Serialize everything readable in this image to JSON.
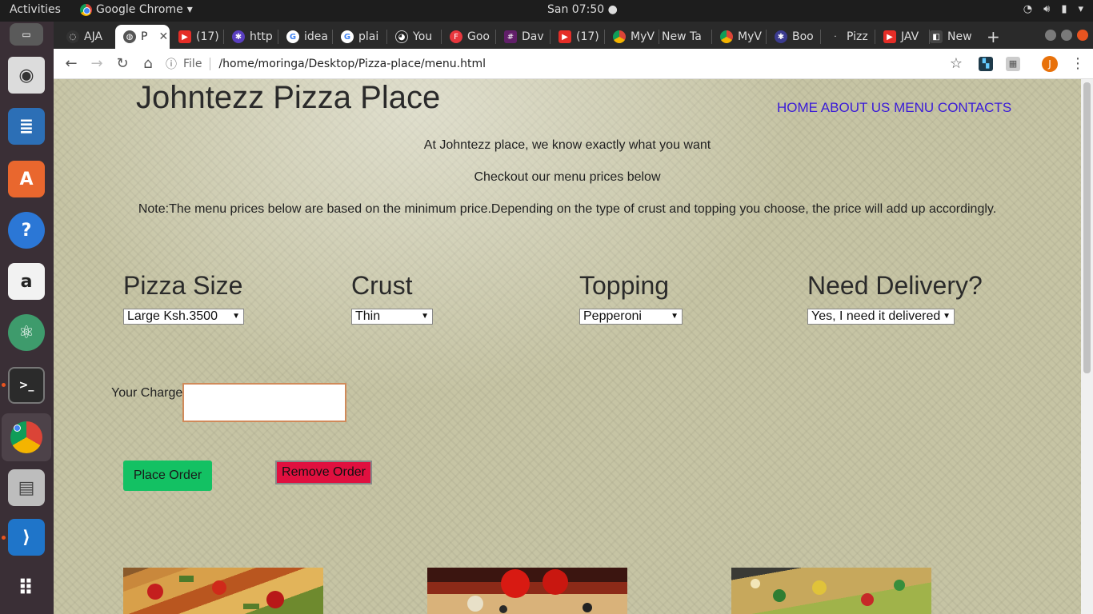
{
  "topbar": {
    "activities": "Activities",
    "app_name": "Google Chrome",
    "clock": "San 07:50"
  },
  "dock": {
    "items": [
      "rhythmbox",
      "libreoffice-writer",
      "ubuntu-software",
      "help",
      "amazon",
      "atom",
      "terminal",
      "chrome",
      "scanner",
      "vscode",
      "show-applications"
    ]
  },
  "tabs": [
    {
      "label": "AJA"
    },
    {
      "label": "P",
      "active": true
    },
    {
      "label": "(17)"
    },
    {
      "label": "http"
    },
    {
      "label": "idea"
    },
    {
      "label": "plai"
    },
    {
      "label": "You"
    },
    {
      "label": "Goo"
    },
    {
      "label": "Dav"
    },
    {
      "label": "(17)"
    },
    {
      "label": "MyV"
    },
    {
      "label": "New Ta"
    },
    {
      "label": "MyV"
    },
    {
      "label": "Boo"
    },
    {
      "label": "Pizz"
    },
    {
      "label": "JAV"
    },
    {
      "label": "New"
    }
  ],
  "toolbar": {
    "file_label": "File",
    "url": "/home/moringa/Desktop/Pizza-place/menu.html",
    "profile_initial": "J"
  },
  "page": {
    "title": "Johntezz Pizza Place",
    "nav": [
      "HOME",
      "ABOUT US",
      "MENU",
      "CONTACTS"
    ],
    "intro1": "At Johntezz place, we know exactly what you want",
    "intro2": "Checkout our menu prices below",
    "note": "Note:The menu prices below are based on the minimum price.Depending on the type of crust and topping you choose, the price will add up accordingly.",
    "fields": [
      {
        "heading": "Pizza Size",
        "selected": "Large Ksh.3500"
      },
      {
        "heading": "Crust",
        "selected": "Thin"
      },
      {
        "heading": "Topping",
        "selected": "Pepperoni"
      },
      {
        "heading": "Need Delivery?",
        "selected": "Yes, I need it delivered"
      }
    ],
    "charge_label": "Your Charge",
    "charge_value": "",
    "place_order": "Place Order",
    "remove_order": "Remove Order"
  },
  "colors": {
    "nav_link": "#3a1bd8",
    "place_button": "#13c163",
    "remove_button": "#e0103f",
    "page_bg": "#c6c4a4"
  }
}
